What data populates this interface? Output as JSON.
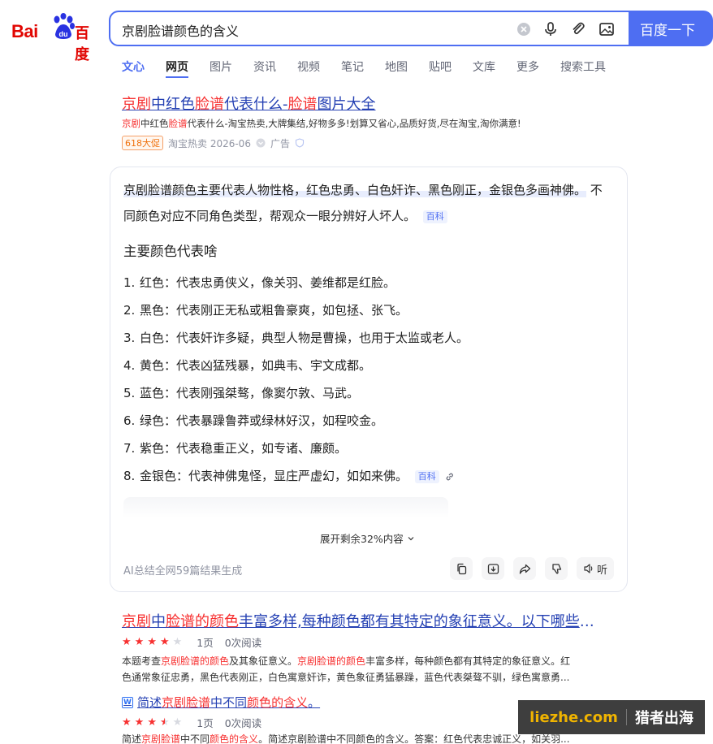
{
  "header": {
    "logo_text": "Bai",
    "logo_cn": "百度",
    "query": "京剧脸谱颜色的含义",
    "search_button": "百度一下"
  },
  "tabs": [
    "文心",
    "网页",
    "图片",
    "资讯",
    "视频",
    "笔记",
    "地图",
    "贴吧",
    "文库",
    "更多",
    "搜索工具"
  ],
  "result1": {
    "title_parts": [
      "京剧",
      "中红色",
      "脸谱",
      "代表什么-",
      "脸谱",
      "图片大全"
    ],
    "desc_parts": [
      "京剧",
      "中红色",
      "脸谱",
      "代表什么-淘宝热卖,大牌集结,好物多多!划算又省心,品质好货,尽在淘宝,淘你满意!"
    ],
    "badge": "618大促",
    "source": "淘宝热卖 2026-06",
    "ad": "广告"
  },
  "ai": {
    "summary_hl": "京剧脸谱颜色主要代表人物性格，红色忠勇、白色奸诈、黑色刚正，金银色多画神佛。",
    "summary_rest": "不同颜色对应不同角色类型，帮观众一眼分辨好人坏人。",
    "baike": "百科",
    "heading": "主要颜色代表啥",
    "items": [
      {
        "num": "1.",
        "text": "红色：代表忠勇侠义，像关羽、姜维都是红脸。"
      },
      {
        "num": "2.",
        "text": "黑色：代表刚正无私或粗鲁豪爽，如包拯、张飞。"
      },
      {
        "num": "3.",
        "text": "白色：代表奸诈多疑，典型人物是曹操，也用于太监或老人。"
      },
      {
        "num": "4.",
        "text": "黄色：代表凶猛残暴，如典韦、宇文成都。"
      },
      {
        "num": "5.",
        "text": "蓝色：代表刚强桀骜，像窦尔敦、马武。"
      },
      {
        "num": "6.",
        "text": "绿色：代表暴躁鲁莽或绿林好汉，如程咬金。"
      },
      {
        "num": "7.",
        "text": "紫色：代表稳重正义，如专诸、廉颇。"
      },
      {
        "num": "8.",
        "text": "金银色：代表神佛鬼怪，显庄严虚幻，如如来佛。"
      }
    ],
    "expand": "展开剩余32%内容",
    "footer": "AI总结全网59篇结果生成",
    "tool_listen": "听"
  },
  "result2": {
    "title_parts": [
      "京剧",
      "中",
      "脸谱的颜色",
      "丰富多样,每种颜色都有其特定的象征意义。以下哪些颜色代表..."
    ],
    "pages": "1页",
    "reads": "0次阅读",
    "desc_line1_parts": [
      "本题考查",
      "京剧脸谱的颜色",
      "及其象征意义。",
      "京剧脸谱的颜色",
      "丰富多样，每种颜色都有其特定的象征意义。红"
    ],
    "desc_line2": "色通常象征忠勇，黑色代表刚正，白色寓意奸诈，黄色象征勇猛暴躁，蓝色代表桀骜不驯，绿色寓意勇...",
    "sub_title_parts": [
      "简述",
      "京剧脸谱",
      "中不同",
      "颜色",
      "的含义",
      "。"
    ],
    "sub_pages": "1页",
    "sub_reads": "0次阅读",
    "sub_desc_parts": [
      "简述",
      "京剧脸谱",
      "中不同",
      "颜色的含义",
      "。简述京剧脸谱中不同颜色的含义。答案：红色代表忠诚正义，如关羽..."
    ],
    "sub_icon": "W"
  },
  "watermark": {
    "en": "liezhe.com",
    "cn": "猎者出海"
  }
}
